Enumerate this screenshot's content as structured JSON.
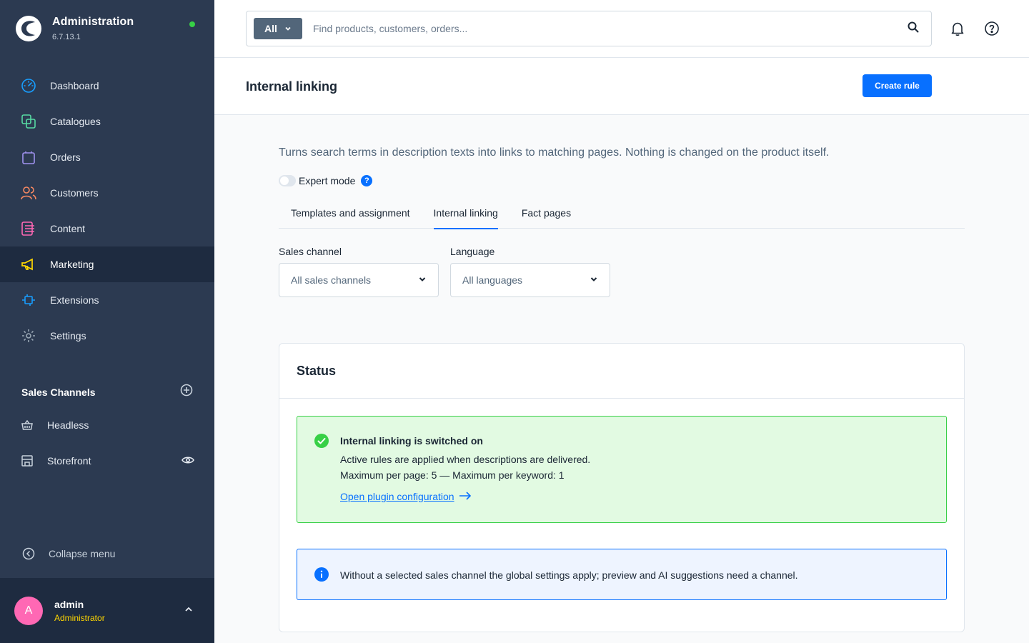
{
  "sidebar": {
    "brand_title": "Administration",
    "version": "6.7.13.1",
    "items": [
      {
        "label": "Dashboard",
        "icon": "dashboard-icon",
        "color": "#189eff"
      },
      {
        "label": "Catalogues",
        "icon": "catalogues-icon",
        "color": "#57d9a3"
      },
      {
        "label": "Orders",
        "icon": "orders-icon",
        "color": "#a092f0"
      },
      {
        "label": "Customers",
        "icon": "customers-icon",
        "color": "#f88962"
      },
      {
        "label": "Content",
        "icon": "content-icon",
        "color": "#ff68b4"
      },
      {
        "label": "Marketing",
        "icon": "marketing-icon",
        "color": "#ffd700",
        "active": true
      },
      {
        "label": "Extensions",
        "icon": "extensions-icon",
        "color": "#189eff"
      },
      {
        "label": "Settings",
        "icon": "settings-icon",
        "color": "#9aa8b5"
      }
    ],
    "sales_channels_title": "Sales Channels",
    "sales_channels": [
      {
        "label": "Headless",
        "icon": "basket-icon"
      },
      {
        "label": "Storefront",
        "icon": "storefront-icon"
      }
    ],
    "collapse_label": "Collapse menu",
    "user": {
      "initial": "A",
      "name": "admin",
      "role": "Administrator"
    }
  },
  "topbar": {
    "search_type": "All",
    "search_placeholder": "Find products, customers, orders..."
  },
  "page": {
    "title": "Internal linking",
    "create_button": "Create rule",
    "intro": "Turns search terms in description texts into links to matching pages. Nothing is changed on the product itself.",
    "expert_mode_label": "Expert mode",
    "expert_mode_on": false,
    "help_icon_text": "?",
    "tabs": [
      {
        "label": "Templates and assignment",
        "active": false
      },
      {
        "label": "Internal linking",
        "active": true
      },
      {
        "label": "Fact pages",
        "active": false
      }
    ],
    "sales_channel_label": "Sales channel",
    "sales_channel_value": "All sales channels",
    "language_label": "Language",
    "language_value": "All languages"
  },
  "status_card": {
    "title": "Status",
    "success": {
      "title": "Internal linking is switched on",
      "line1": "Active rules are applied when descriptions are delivered.",
      "line2": "Maximum per page: 5 — Maximum per keyword: 1",
      "link": "Open plugin configuration"
    },
    "info": {
      "text": "Without a selected sales channel the global settings apply; preview and AI suggestions need a channel."
    }
  },
  "colors": {
    "sidebar_bg": "#2c3a51",
    "sidebar_active_bg": "#1e2b40",
    "primary": "#0870ff",
    "success": "#37d046",
    "success_bg": "#e2fae2",
    "info_bg": "#eef4ff",
    "role": "#ffd700",
    "avatar": "#ff68b4"
  }
}
